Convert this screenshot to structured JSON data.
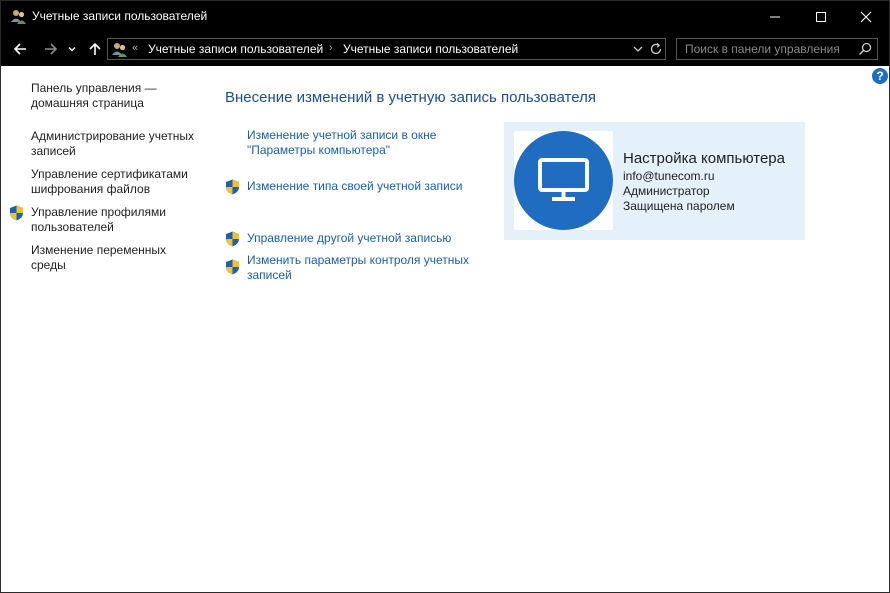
{
  "window": {
    "title": "Учетные записи пользователей",
    "app_icon": "users-icon",
    "controls": [
      "minimize-icon",
      "maximize-icon",
      "close-icon"
    ]
  },
  "navbar": {
    "breadcrumb_prefix": "«",
    "breadcrumbs": [
      "Учетные записи пользователей",
      "Учетные записи пользователей"
    ],
    "separator": "›",
    "search_placeholder": "Поиск в панели управления"
  },
  "help": {
    "label": "?"
  },
  "sidebar": {
    "home_link": "Панель управления — домашняя страница",
    "items": [
      {
        "label": "Администрирование учетных записей",
        "shield": false
      },
      {
        "label": "Управление сертификатами шифрования файлов",
        "shield": false
      },
      {
        "label": "Управление профилями пользователей",
        "shield": true
      },
      {
        "label": "Изменение переменных среды",
        "shield": false
      }
    ]
  },
  "main": {
    "heading": "Внесение изменений в учетную запись пользователя",
    "tasks": [
      {
        "label": "Изменение учетной записи в окне \"Параметры компьютера\"",
        "shield": false
      },
      {
        "label": "Изменение типа своей учетной записи",
        "shield": true
      },
      {
        "label": "Управление другой учетной записью",
        "shield": true
      },
      {
        "label": "Изменить параметры контроля учетных записей",
        "shield": true
      }
    ]
  },
  "account": {
    "name": "Настройка компьютера",
    "email": "info@tunecom.ru",
    "role": "Администратор",
    "protection": "Защищена паролем",
    "avatar_icon": "monitor-icon"
  },
  "colors": {
    "titlebar": "#000000",
    "link": "#1a5fa8",
    "heading": "#1e4e8c",
    "card_bg": "#e4f1fb",
    "avatar": "#1f6cc0"
  }
}
